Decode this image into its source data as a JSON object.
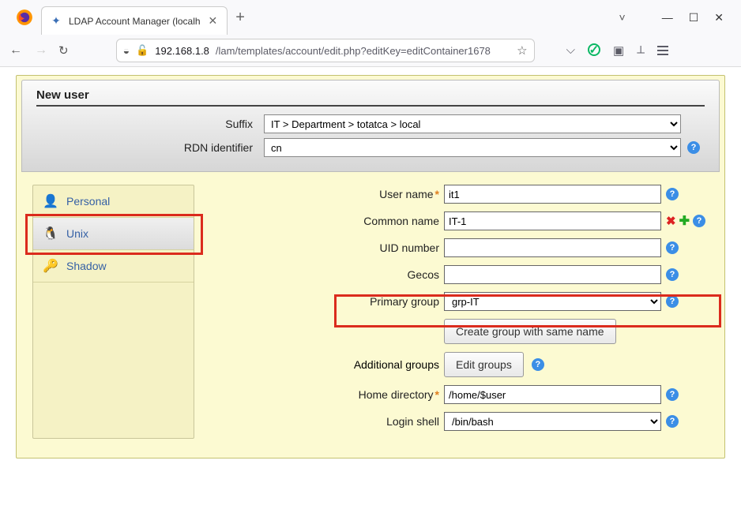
{
  "browser": {
    "tab_title": "LDAP Account Manager (localh",
    "url_host": "192.168.1.8",
    "url_path": "/lam/templates/account/edit.php?editKey=editContainer1678"
  },
  "page_header": {
    "title": "New user",
    "suffix_label": "Suffix",
    "suffix_value": "IT > Department > totatca > local",
    "rdn_label": "RDN identifier",
    "rdn_value": "cn"
  },
  "side_tabs": {
    "personal": "Personal",
    "unix": "Unix",
    "shadow": "Shadow"
  },
  "form": {
    "username_label": "User name",
    "username_value": "it1",
    "commonname_label": "Common name",
    "commonname_value": "IT-1",
    "uid_label": "UID number",
    "uid_value": "",
    "gecos_label": "Gecos",
    "gecos_value": "",
    "primarygroup_label": "Primary group",
    "primarygroup_value": "grp-IT",
    "create_group_btn": "Create group with same name",
    "additionalgroups_label": "Additional groups",
    "edit_groups_btn": "Edit groups",
    "homedir_label": "Home directory",
    "homedir_value": "/home/$user",
    "loginshell_label": "Login shell",
    "loginshell_value": "/bin/bash"
  }
}
